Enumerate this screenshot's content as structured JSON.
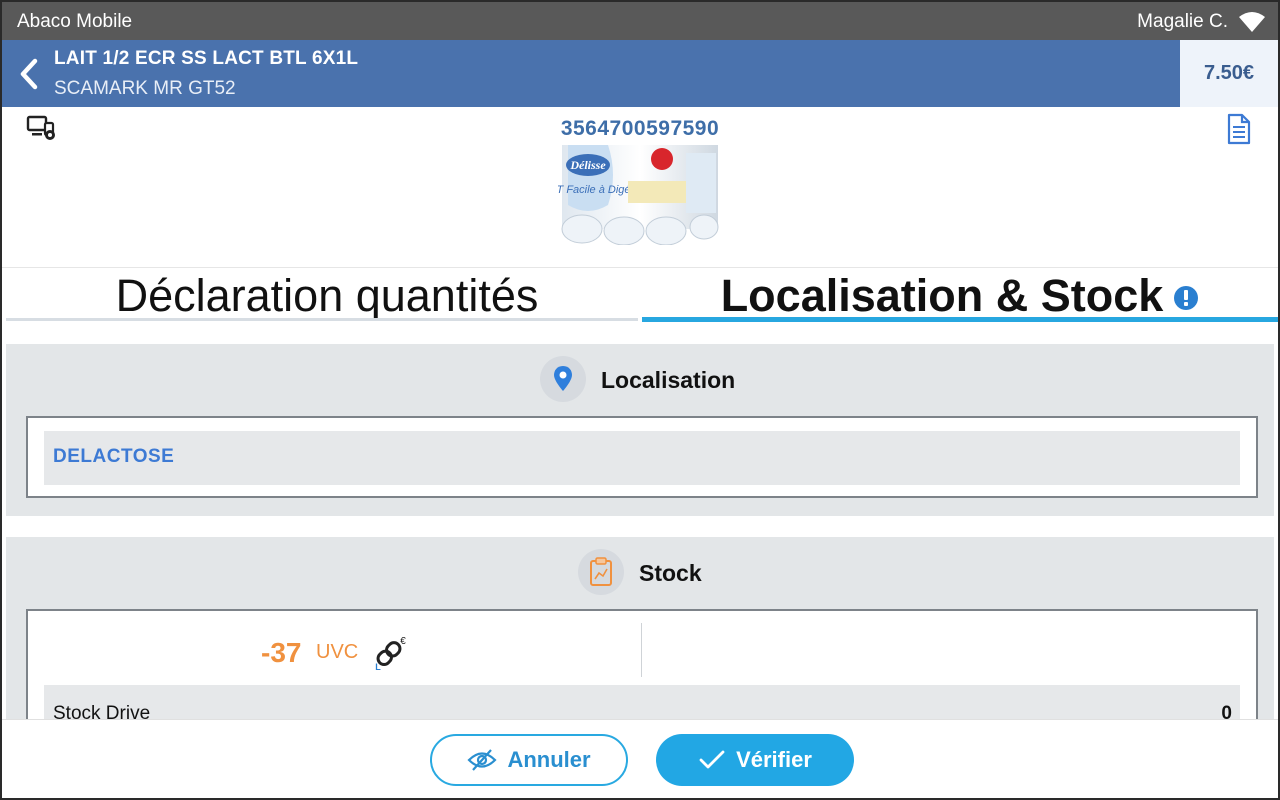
{
  "statusbar": {
    "app_name": "Abaco Mobile",
    "user": "Magalie C."
  },
  "header": {
    "title": "LAIT 1/2 ECR SS LACT BTL 6X1L",
    "subtitle": "SCAMARK MR GT52",
    "price": "7.50€"
  },
  "product": {
    "barcode": "3564700597590",
    "image_icon": "product-photo",
    "image_brand": "Délisse",
    "image_text": "LAIT Facile à Digérer"
  },
  "tabs": [
    {
      "label": "Déclaration quantités",
      "active": false
    },
    {
      "label": "Localisation & Stock",
      "active": true
    }
  ],
  "localisation": {
    "title": "Localisation",
    "icon": "location-pin-icon",
    "value": "DELACTOSE"
  },
  "stock": {
    "title": "Stock",
    "icon": "clipboard-chart-icon",
    "quantity": "-37",
    "unit": "UVC",
    "link_icon": "link-euro-icon",
    "drive_label": "Stock Drive",
    "drive_value": "0"
  },
  "footer": {
    "cancel_label": "Annuler",
    "verify_label": "Vérifier"
  },
  "colors": {
    "header": "#4a72ad",
    "accent": "#22a7e4",
    "stock_negative": "#f0913f",
    "barcode": "#3e6ea8"
  }
}
